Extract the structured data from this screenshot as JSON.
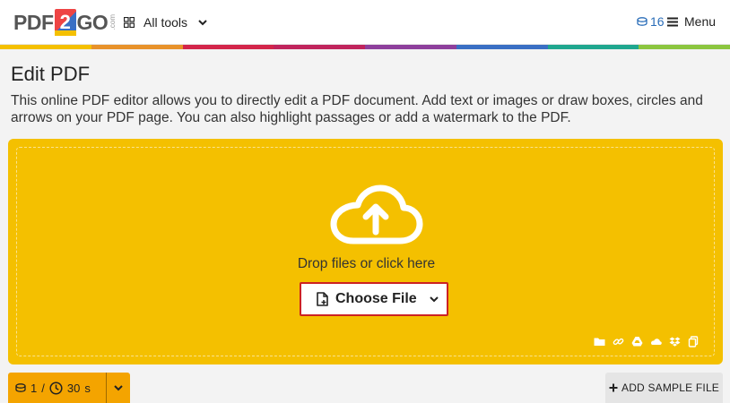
{
  "header": {
    "logo_left": "PDF",
    "logo_num": "2",
    "logo_right": "GO",
    "logo_dotcom": ".com",
    "alltools_label": "All tools",
    "credits": "16",
    "menu_label": "Menu"
  },
  "colors": {
    "brand_yellow": "#f4c000",
    "accent_bar": [
      "#f4c000",
      "#e8922a",
      "#d3254a",
      "#c0245c",
      "#8e3f9c",
      "#3a6fc4",
      "#1fa78f",
      "#8cc63f"
    ],
    "choose_border": "#cc2222",
    "link_blue": "#2a6db8"
  },
  "page": {
    "title": "Edit PDF",
    "description": "This online PDF editor allows you to directly edit a PDF document. Add text or images or draw boxes, circles and arrows on your PDF page. You can also highlight passages or add a watermark to the PDF."
  },
  "upload": {
    "drop_text": "Drop files or click here",
    "choose_label": "Choose File",
    "sources": [
      "folder-icon",
      "link-icon",
      "google-drive-icon",
      "onedrive-icon",
      "dropbox-icon",
      "clipboard-icon"
    ]
  },
  "footer": {
    "files": "1",
    "separator": "/",
    "seconds": "30",
    "seconds_unit": "s",
    "sample_label": "ADD SAMPLE FILE"
  }
}
